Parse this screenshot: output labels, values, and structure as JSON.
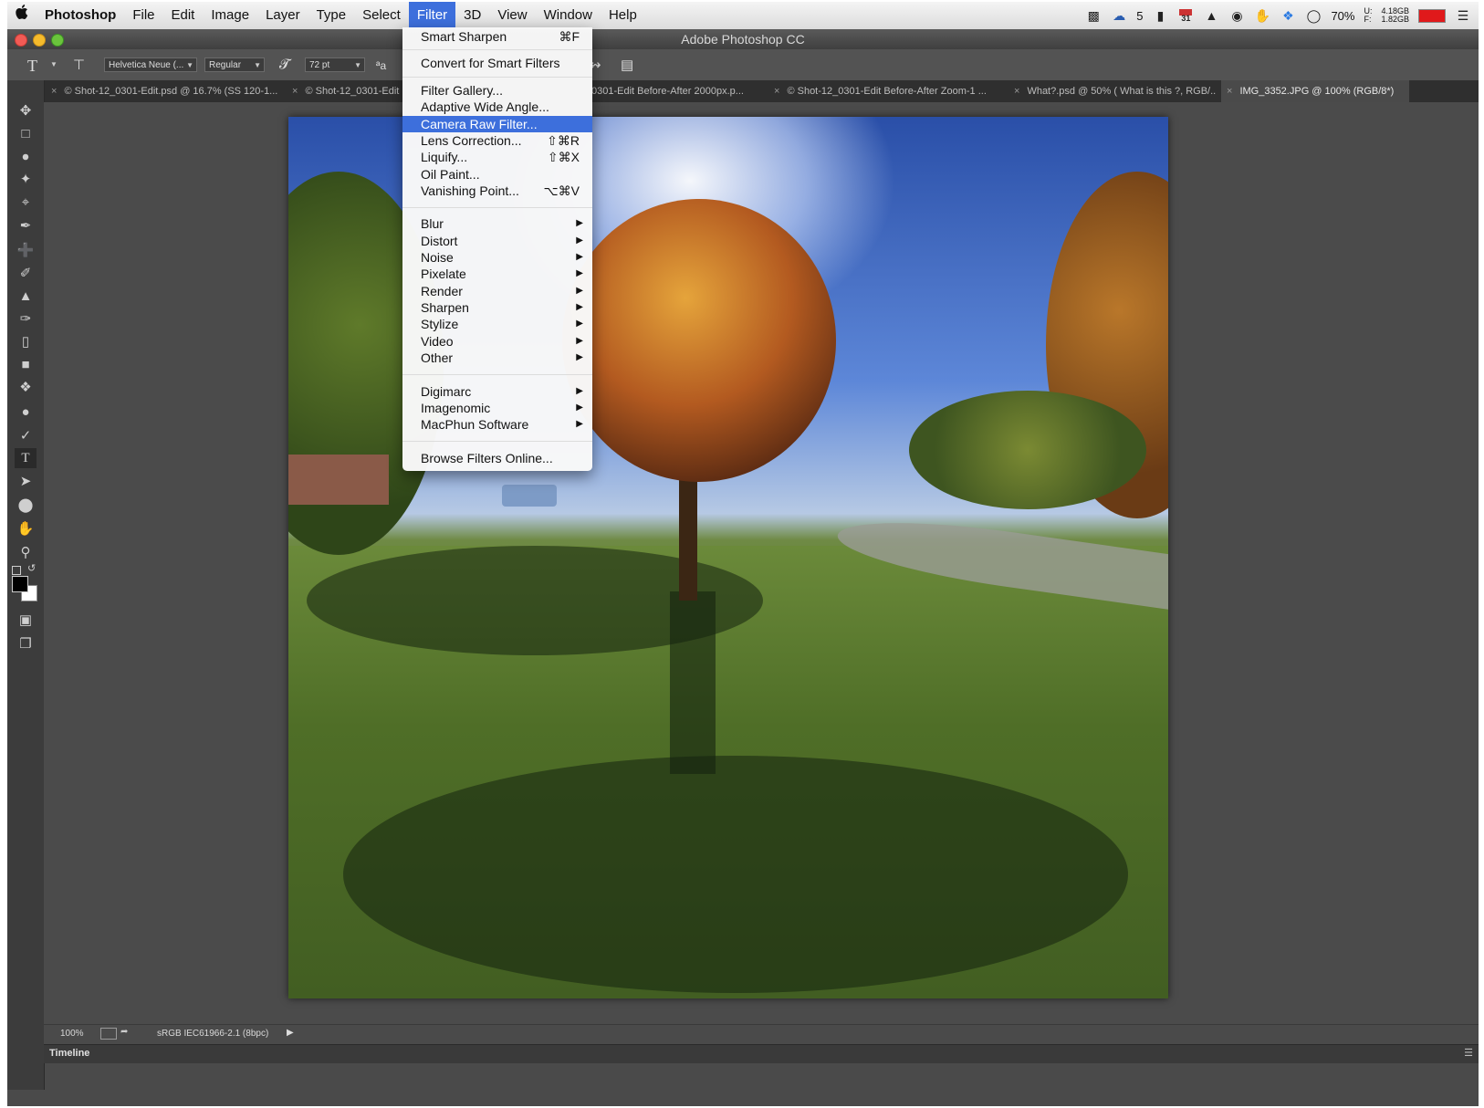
{
  "menubar": {
    "apple": "",
    "app": "Photoshop",
    "items": [
      "File",
      "Edit",
      "Image",
      "Layer",
      "Type",
      "Select",
      "Filter",
      "3D",
      "View",
      "Window",
      "Help"
    ],
    "active": "Filter",
    "tray": {
      "badge_count": "5",
      "calendar_day": "31",
      "battery_percent": "70%",
      "mem_label_u": "U:",
      "mem_label_f": "F:",
      "mem_used": "4.18GB",
      "mem_free": "1.82GB"
    }
  },
  "window": {
    "title": "Adobe Photoshop CC"
  },
  "options_bar": {
    "font_family": "Helvetica Neue (...",
    "font_style": "Regular",
    "font_size": "72 pt",
    "aa_label": "ªa"
  },
  "tabs": [
    {
      "label": "Shot-12_0301-Edit.psd @ 16.7% (SS 120-1..."
    },
    {
      "label": "Shot-12_0301-Edit"
    },
    {
      "label": "0301-Edit Before-After 2000px.p..."
    },
    {
      "label": "Shot-12_0301-Edit Before-After Zoom-1 ..."
    },
    {
      "label": "What?.psd @ 50% ( What is this ?, RGB/..."
    },
    {
      "label": "IMG_3352.JPG @ 100% (RGB/8*)"
    }
  ],
  "filter_menu": {
    "items": [
      {
        "label": "Smart Sharpen",
        "shortcut": "⌘F"
      },
      {
        "label": "Convert for Smart Filters",
        "shortcut": ""
      },
      {
        "label": "Filter Gallery...",
        "shortcut": ""
      },
      {
        "label": "Adaptive Wide Angle...",
        "shortcut": ""
      },
      {
        "label": "Camera Raw Filter...",
        "shortcut": "",
        "highlighted": true
      },
      {
        "label": "Lens Correction...",
        "shortcut": "⇧⌘R"
      },
      {
        "label": "Liquify...",
        "shortcut": "⇧⌘X"
      },
      {
        "label": "Oil Paint...",
        "shortcut": ""
      },
      {
        "label": "Vanishing Point...",
        "shortcut": "⌥⌘V"
      },
      {
        "label": "Blur",
        "submenu": true
      },
      {
        "label": "Distort",
        "submenu": true
      },
      {
        "label": "Noise",
        "submenu": true
      },
      {
        "label": "Pixelate",
        "submenu": true
      },
      {
        "label": "Render",
        "submenu": true
      },
      {
        "label": "Sharpen",
        "submenu": true
      },
      {
        "label": "Stylize",
        "submenu": true
      },
      {
        "label": "Video",
        "submenu": true
      },
      {
        "label": "Other",
        "submenu": true
      },
      {
        "label": "Digimarc",
        "submenu": true
      },
      {
        "label": "Imagenomic",
        "submenu": true
      },
      {
        "label": "MacPhun Software",
        "submenu": true
      },
      {
        "label": "Browse Filters Online...",
        "shortcut": ""
      }
    ]
  },
  "status": {
    "zoom": "100%",
    "profile": "sRGB IEC61966-2.1 (8bpc)"
  },
  "timeline": {
    "label": "Timeline"
  },
  "colors": {
    "menu_highlight": "#3d6fdc",
    "panel_bg": "#4a4a4a",
    "battery": "#e0191b"
  }
}
